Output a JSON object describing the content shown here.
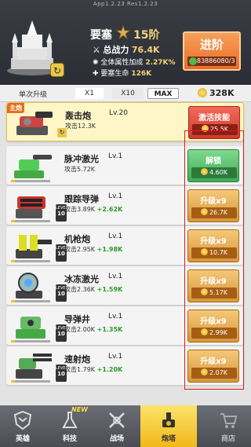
{
  "version": "App1.2.23   Res1.2.23",
  "header": {
    "rank_title": "要塞",
    "rank_level": "15阶",
    "power_label": "总战力",
    "power_value": "76.4K",
    "bonus_label": "全体属性加成",
    "bonus_value": "2.27K%",
    "fort_label": "要塞生命",
    "fort_value": "126K",
    "advance_label": "进阶",
    "advance_cost": "83886080/3"
  },
  "toolbar": {
    "label": "单次升级",
    "x1": "X1",
    "x10": "X10",
    "max": "MAX",
    "gold": "328K"
  },
  "weapons": [
    {
      "main_tag": "主炮",
      "name": "轰击炮",
      "level": "Lv.20",
      "attack": "攻击12.3K",
      "plus": "",
      "lvl_box": "",
      "action": "激活技能",
      "cost": "25.5K",
      "type": "activate"
    },
    {
      "main_tag": "",
      "name": "脉冲激光",
      "level": "Lv.1",
      "attack": "攻击5.72K",
      "plus": "",
      "lvl_box": "",
      "action": "解锁",
      "cost": "4.60K",
      "type": "unlock"
    },
    {
      "main_tag": "",
      "name": "跟踪导弹",
      "level": "Lv.1",
      "attack": "攻击3.89K",
      "plus": "+2.62K",
      "lvl_box": "10",
      "action": "升级x9",
      "cost": "26.7K",
      "type": "upgrade"
    },
    {
      "main_tag": "",
      "name": "机枪炮",
      "level": "Lv.1",
      "attack": "攻击2.95K",
      "plus": "+1.98K",
      "lvl_box": "10",
      "action": "升级x9",
      "cost": "10.7K",
      "type": "upgrade"
    },
    {
      "main_tag": "",
      "name": "冰冻激光",
      "level": "Lv.1",
      "attack": "攻击2.36K",
      "plus": "+1.59K",
      "lvl_box": "10",
      "action": "升级x9",
      "cost": "5.17K",
      "type": "upgrade"
    },
    {
      "main_tag": "",
      "name": "导弹井",
      "level": "Lv.1",
      "attack": "攻击2.00K",
      "plus": "+1.35K",
      "lvl_box": "10",
      "action": "升级x9",
      "cost": "2.99K",
      "type": "upgrade"
    },
    {
      "main_tag": "",
      "name": "速射炮",
      "level": "Lv.1",
      "attack": "攻击1.79K",
      "plus": "+1.20K",
      "lvl_box": "10",
      "action": "升级x9",
      "cost": "2.07K",
      "type": "upgrade"
    }
  ],
  "lvl_label": "LEVEL",
  "nav": {
    "hero": "英雄",
    "tech": "科技",
    "tech_badge": "NEW",
    "battle": "战场",
    "turret": "炮塔",
    "shop": "商店"
  },
  "colors": {
    "accent": "#f2b81a",
    "upgrade": "#d9953a",
    "unlock": "#3faa57",
    "activate": "#d13a2c"
  }
}
